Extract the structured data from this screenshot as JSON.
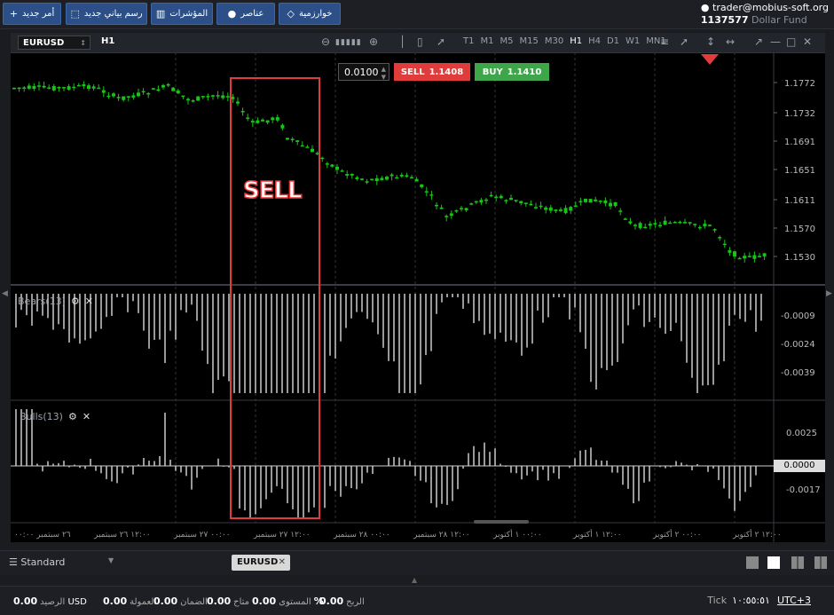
{
  "topbar": {
    "buttons": [
      {
        "label": "أمر جديد",
        "icon": "+"
      },
      {
        "label": "رسم بياني جديد",
        "icon": "⬚"
      },
      {
        "label": "المؤشرات",
        "icon": "▥"
      },
      {
        "label": "عناصر",
        "icon": "●"
      },
      {
        "label": "خوارزمية",
        "icon": "◇"
      }
    ],
    "user": "trader@mobius-soft.org",
    "account_id": "1137577",
    "account_name": "Dollar Fund"
  },
  "chart": {
    "symbol": "EURUSD",
    "timeframe": "H1",
    "timeframes": [
      "T1",
      "M1",
      "M5",
      "M15",
      "M30",
      "H1",
      "H4",
      "D1",
      "W1",
      "MN1"
    ],
    "active_timeframe": "H1",
    "lots": "0.0100",
    "sell_label": "SELL",
    "sell_price": "1.1408",
    "buy_label": "BUY",
    "buy_price": "1.1410",
    "sell_color": "#e03c3c",
    "buy_color": "#3fa54a",
    "price_axis": [
      "1.1772",
      "1.1732",
      "1.1691",
      "1.1651",
      "1.1611",
      "1.1570",
      "1.1530"
    ],
    "bears_label": "Bears(13)",
    "bears_axis": [
      "-0.0009",
      "-0.0024",
      "-0.0039"
    ],
    "bulls_label": "Bulls(13)",
    "bulls_axis": [
      "0.0025",
      "-0.0017"
    ],
    "bulls_zero_tag": "0.0000",
    "time_axis": [
      "٢٦ سبتمبر ٠٠:٠٠",
      "١٢:٠٠ ٢٦ سبتمبر",
      "٠٠:٠٠ ٢٧ سبتمبر",
      "١٢:٠٠ ٢٧ سبتمبر",
      "٠٠:٠٠ ٢٨ سبتمبر",
      "١٢:٠٠ ٢٨ سبتمبر",
      "٠٠:٠٠ ١ أكتوبر",
      "١٢:٠٠ ١ أكتوبر",
      "٠٠:٠٠ ٢ أكتوبر",
      "١٢:٠٠ ٢ أكتوبر"
    ],
    "annotation_text": "SELL"
  },
  "bottom": {
    "template": "Standard",
    "symbol_tab": "EURUSD",
    "balance_value": "0.00",
    "balance_label": "الرصيد",
    "currency": "USD",
    "commission_value": "0.00",
    "commission_label": "العمولة",
    "margin_value": "0.00",
    "margin_label": "الضمان",
    "free_value": "0.00",
    "free_label": "متاح",
    "level_value": "0.00",
    "level_unit": "%",
    "level_label": "المستوى",
    "profit_value": "0.00",
    "profit_label": "الربح",
    "tick_label": "Tick",
    "tick_time": "١٠:٥٥:٥١",
    "timezone": "UTC+3"
  }
}
